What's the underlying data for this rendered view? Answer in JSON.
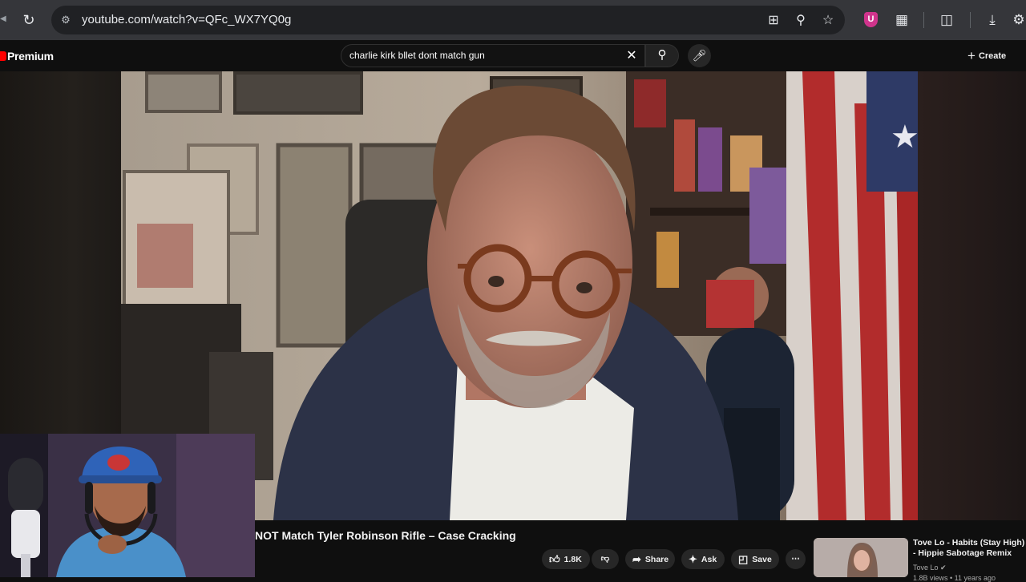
{
  "browser": {
    "url": "youtube.com/watch?v=QFc_WX7YQ0g",
    "icons": [
      "reload-icon",
      "site-info-icon",
      "install-app-icon",
      "zoom-icon",
      "bookmark-star-icon",
      "ublock-extension-icon",
      "extensions-puzzle-icon",
      "reading-mode-icon",
      "download-icon",
      "profile-icon"
    ],
    "extension_badge": "U"
  },
  "youtube": {
    "logo_label": "Premium",
    "search": {
      "value": "charlie kirk bllet dont match gun",
      "placeholder": "Search"
    },
    "create_label": "Create",
    "brand_color": "#ff0000"
  },
  "video": {
    "title": "NOT Match Tyler Robinson Rifle – Case Cracking",
    "actions": {
      "like_count": "1.8K",
      "share_label": "Share",
      "ask_label": "Ask",
      "save_label": "Save"
    }
  },
  "recommendation": {
    "title": "Tove Lo - Habits (Stay High) - Hippie Sabotage Remix",
    "channel": "Tove Lo",
    "meta": "1.8B views • 11 years ago"
  }
}
